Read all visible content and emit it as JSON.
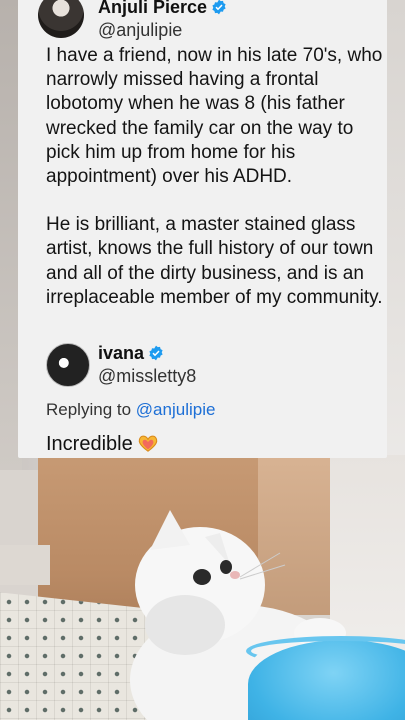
{
  "tweet": {
    "author_name": "Anjuli Pierce",
    "author_handle": "@anjulipie",
    "paragraphs": [
      "I have a friend, now in his late 70's, who narrowly missed having a frontal lobotomy when he was 8 (his father wrecked the family car on the way to pick him up from home for his appointment) over his ADHD.",
      "He is brilliant, a master stained glass artist, knows the full history of our town and all of the dirty business, and is an irreplaceable member of my community."
    ]
  },
  "reply": {
    "author_name": "ivana",
    "author_handle": "@missletty8",
    "replying_prefix": "Replying to",
    "replying_mention": "@anjulipie",
    "text": "Incredible",
    "emoji": "heart-hands-emoji"
  },
  "colors": {
    "card_bg": "#f1f1f1",
    "verified_blue": "#1d9bf0",
    "mention_blue": "#1d6fd6",
    "bucket_blue": "#3fb3e6"
  },
  "icons": {
    "verified": "verified-badge-icon"
  }
}
